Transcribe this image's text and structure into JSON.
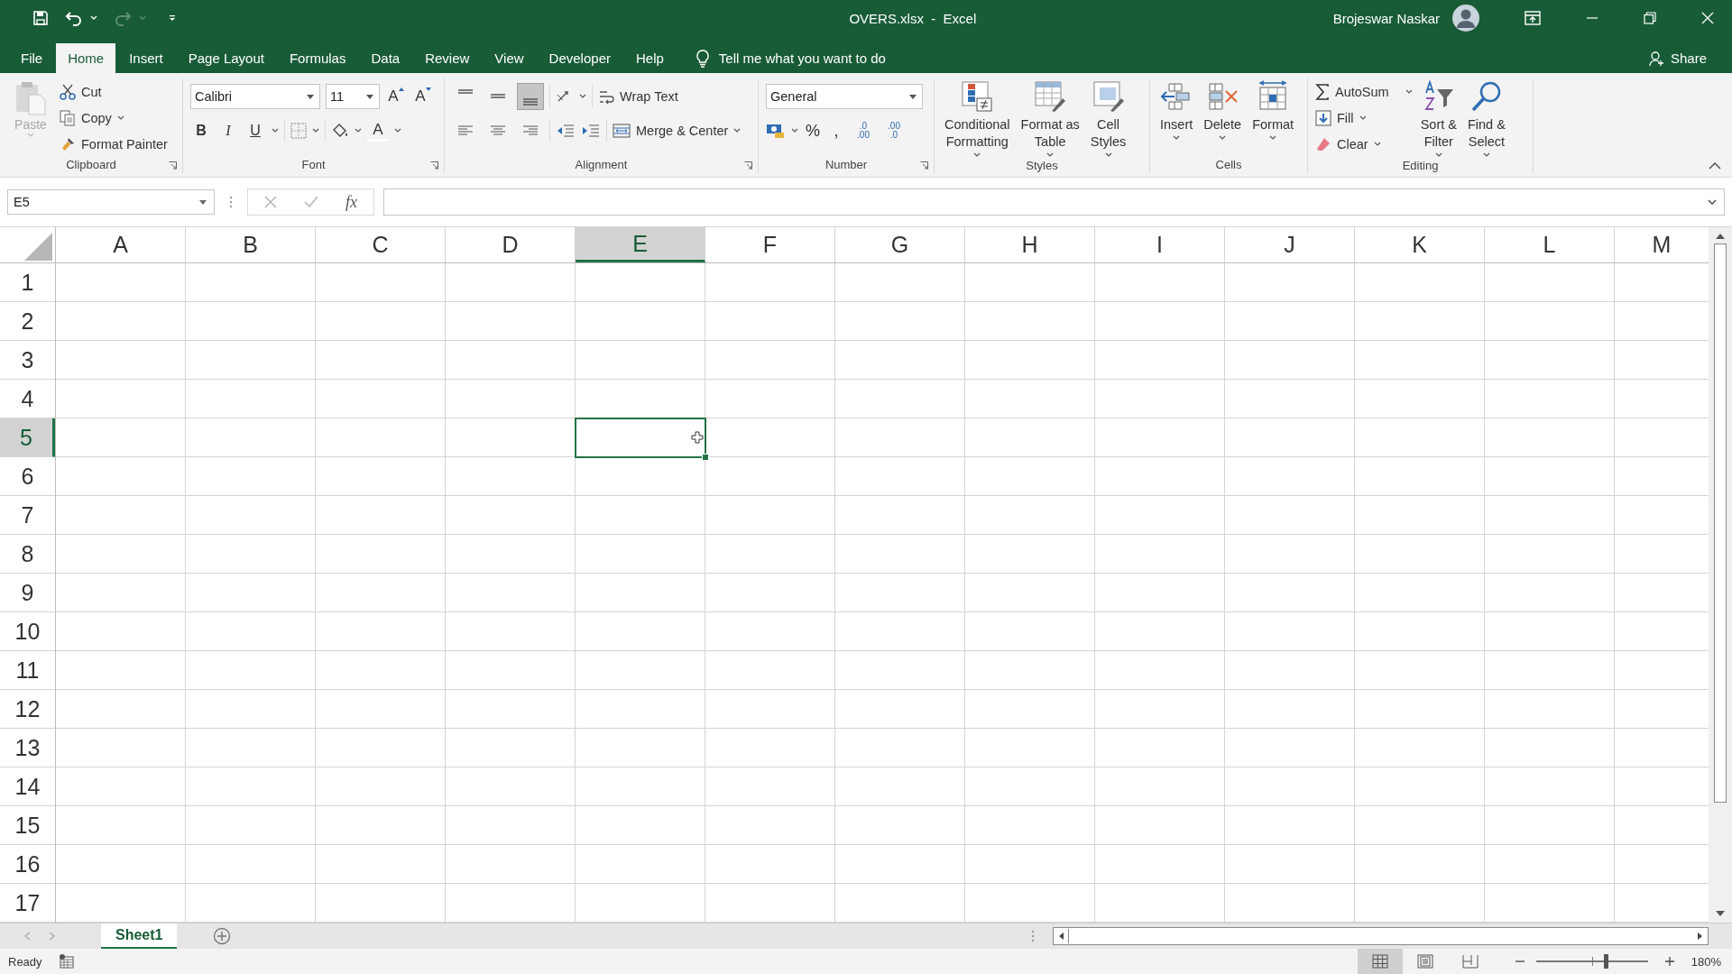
{
  "window": {
    "title": "OVERS.xlsx  -  Excel",
    "user": "Brojeswar Naskar"
  },
  "ribbon_tabs": [
    {
      "label": "File",
      "selected": false
    },
    {
      "label": "Home",
      "selected": true
    },
    {
      "label": "Insert",
      "selected": false
    },
    {
      "label": "Page Layout",
      "selected": false
    },
    {
      "label": "Formulas",
      "selected": false
    },
    {
      "label": "Data",
      "selected": false
    },
    {
      "label": "Review",
      "selected": false
    },
    {
      "label": "View",
      "selected": false
    },
    {
      "label": "Developer",
      "selected": false
    },
    {
      "label": "Help",
      "selected": false
    }
  ],
  "tell_me": "Tell me what you want to do",
  "share": "Share",
  "clipboard": {
    "label": "Clipboard",
    "paste": {
      "label": "Paste",
      "disabled": true
    },
    "cut": "Cut",
    "copy": "Copy",
    "format_painter": "Format Painter"
  },
  "font": {
    "label": "Font",
    "name": "Calibri",
    "size": "11",
    "grow": "A",
    "shrink": "A",
    "bold": "B",
    "italic": "I",
    "underline": "U",
    "color_letter": "A"
  },
  "alignment": {
    "label": "Alignment",
    "vertical": [
      {
        "selected": false
      },
      {
        "selected": false
      },
      {
        "selected": true
      }
    ],
    "wrap_text": "Wrap Text",
    "merge_center": "Merge & Center"
  },
  "number": {
    "label": "Number",
    "format": "General",
    "percent": "%",
    "comma": ",",
    "increase_decimal": [
      ".0",
      ".00"
    ],
    "decrease_decimal": [
      ".00",
      ".0"
    ]
  },
  "styles": {
    "label": "Styles",
    "buttons": [
      {
        "kind": "conditional",
        "lines": [
          "Conditional",
          "Formatting"
        ]
      },
      {
        "kind": "table",
        "lines": [
          "Format as",
          "Table"
        ]
      },
      {
        "kind": "cell_styles",
        "lines": [
          "Cell",
          "Styles"
        ]
      }
    ]
  },
  "cells": {
    "label": "Cells",
    "buttons": [
      {
        "kind": "insert",
        "lines": [
          "Insert"
        ]
      },
      {
        "kind": "delete",
        "lines": [
          "Delete"
        ]
      },
      {
        "kind": "format",
        "lines": [
          "Format"
        ]
      }
    ]
  },
  "editing": {
    "label": "Editing",
    "autosum": "AutoSum",
    "fill": "Fill",
    "clear": "Clear",
    "buttons": [
      {
        "kind": "sort",
        "lines": [
          "Sort &",
          "Filter"
        ]
      },
      {
        "kind": "find",
        "lines": [
          "Find &",
          "Select"
        ]
      }
    ]
  },
  "formula_bar": {
    "name_box": "E5",
    "fx": "fx"
  },
  "columns": [
    {
      "label": "A",
      "selected": false
    },
    {
      "label": "B",
      "selected": false
    },
    {
      "label": "C",
      "selected": false
    },
    {
      "label": "D",
      "selected": false
    },
    {
      "label": "E",
      "selected": true
    },
    {
      "label": "F",
      "selected": false
    },
    {
      "label": "G",
      "selected": false
    },
    {
      "label": "H",
      "selected": false
    },
    {
      "label": "I",
      "selected": false
    },
    {
      "label": "J",
      "selected": false
    },
    {
      "label": "K",
      "selected": false
    },
    {
      "label": "L",
      "selected": false
    },
    {
      "label": "M",
      "selected": false
    }
  ],
  "rows": [
    {
      "label": "1",
      "selected": false
    },
    {
      "label": "2",
      "selected": false
    },
    {
      "label": "3",
      "selected": false
    },
    {
      "label": "4",
      "selected": false
    },
    {
      "label": "5",
      "selected": true
    },
    {
      "label": "6",
      "selected": false
    },
    {
      "label": "7",
      "selected": false
    },
    {
      "label": "8",
      "selected": false
    },
    {
      "label": "9",
      "selected": false
    },
    {
      "label": "10",
      "selected": false
    },
    {
      "label": "11",
      "selected": false
    },
    {
      "label": "12",
      "selected": false
    },
    {
      "label": "13",
      "selected": false
    },
    {
      "label": "14",
      "selected": false
    },
    {
      "label": "15",
      "selected": false
    },
    {
      "label": "16",
      "selected": false
    },
    {
      "label": "17",
      "selected": false
    }
  ],
  "sheet_tabs": [
    {
      "label": "Sheet1",
      "selected": true
    }
  ],
  "status_bar": {
    "mode": "Ready",
    "views": [
      {
        "kind": "normal",
        "selected": true
      },
      {
        "kind": "page_layout",
        "selected": false
      },
      {
        "kind": "page_break",
        "selected": false
      }
    ],
    "zoom": {
      "level": 0.62,
      "reading": "180%"
    }
  }
}
